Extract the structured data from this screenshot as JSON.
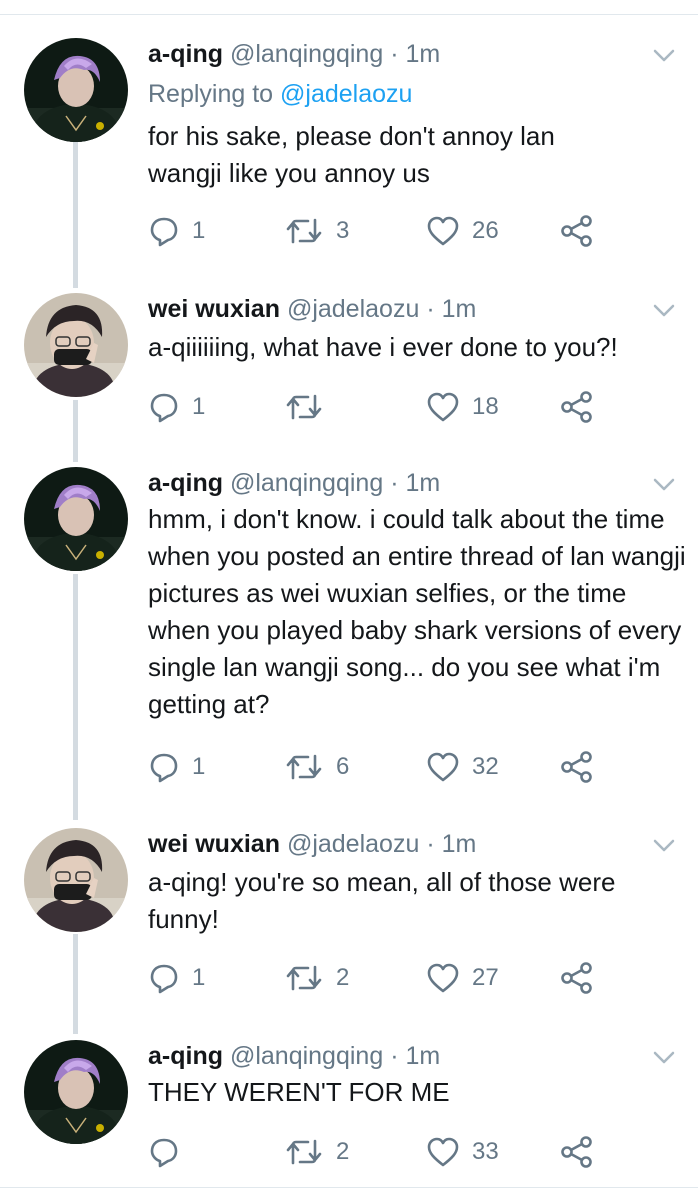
{
  "tweets": [
    {
      "name": "a-qing",
      "handle": "@lanqingqing",
      "sep": "·",
      "time": "1m",
      "reply_prefix": "Replying to",
      "reply_mention": "@jadelaozu",
      "text": "for his sake, please don't annoy lan wangji like you annoy us",
      "replies": "1",
      "retweets": "3",
      "likes": "26"
    },
    {
      "name": "wei wuxian",
      "handle": "@jadelaozu",
      "sep": "·",
      "time": "1m",
      "text": "a-qiiiiiing, what have i ever done to you?!",
      "replies": "1",
      "retweets": "",
      "likes": "18"
    },
    {
      "name": "a-qing",
      "handle": "@lanqingqing",
      "sep": "·",
      "time": "1m",
      "text": "hmm, i don't know. i could talk about the time when you posted an entire thread of lan wangji pictures as wei wuxian selfies, or the time when you played baby shark versions of every single lan wangji song... do you see what i'm getting at?",
      "replies": "1",
      "retweets": "6",
      "likes": "32"
    },
    {
      "name": "wei wuxian",
      "handle": "@jadelaozu",
      "sep": "·",
      "time": "1m",
      "text": "a-qing! you're so mean, all of those were funny!",
      "replies": "1",
      "retweets": "2",
      "likes": "27"
    },
    {
      "name": "a-qing",
      "handle": "@lanqingqing",
      "sep": "·",
      "time": "1m",
      "text": "THEY WEREN'T FOR ME",
      "replies": "",
      "retweets": "2",
      "likes": "33"
    }
  ],
  "icons": {
    "reply": "reply-icon",
    "retweet": "retweet-icon",
    "like": "heart-icon",
    "share": "share-icon",
    "more": "chevron-down-icon"
  },
  "colors": {
    "text": "#14171a",
    "secondary": "#657786",
    "mention": "#1da1f2",
    "thread_line": "#d4dbe1"
  }
}
